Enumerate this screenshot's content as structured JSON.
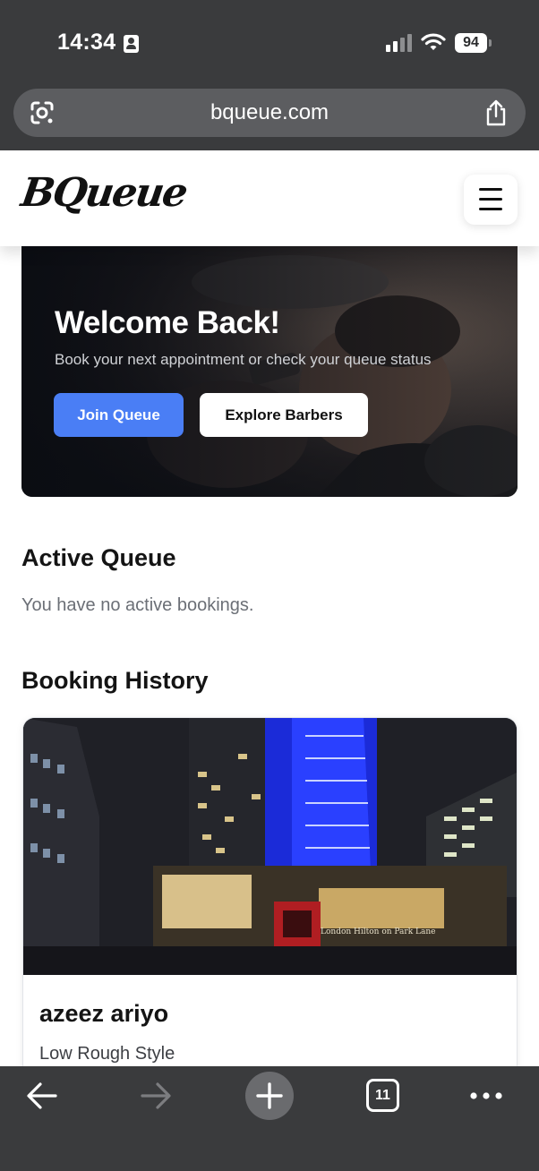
{
  "status_bar": {
    "time": "14:34",
    "battery": "94"
  },
  "browser": {
    "url": "bqueue.com",
    "tab_count": "11"
  },
  "header": {
    "logo": "BQueue"
  },
  "hero": {
    "title": "Welcome Back!",
    "subtitle": "Book your next appointment or check your queue status",
    "join_label": "Join Queue",
    "explore_label": "Explore Barbers"
  },
  "active_queue": {
    "title": "Active Queue",
    "empty_message": "You have no active bookings."
  },
  "booking_history": {
    "title": "Booking History",
    "items": [
      {
        "barber": "azeez ariyo",
        "service": "Low Rough Style",
        "photo_sign": "London Hilton on Park Lane"
      }
    ]
  },
  "colors": {
    "accent": "#4a7ef5",
    "chrome": "#3a3b3d",
    "url_bar": "#5c5d60"
  },
  "icons": [
    "id-card-icon",
    "cellular-signal-icon",
    "wifi-icon",
    "battery-icon",
    "google-lens-icon",
    "share-icon",
    "hamburger-menu-icon",
    "back-arrow-icon",
    "forward-arrow-icon",
    "plus-icon",
    "tabs-icon",
    "more-icon"
  ]
}
